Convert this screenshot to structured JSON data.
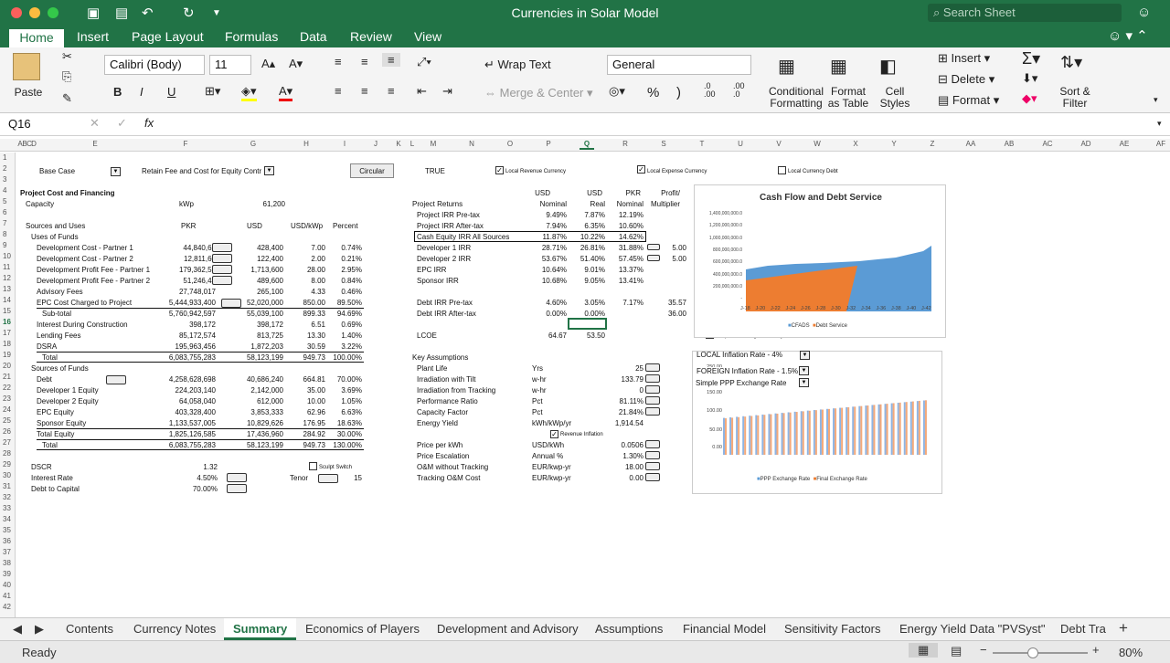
{
  "window": {
    "title": "Currencies in Solar Model",
    "search_placeholder": "Search Sheet"
  },
  "ribbon_tabs": [
    "Home",
    "Insert",
    "Page Layout",
    "Formulas",
    "Data",
    "Review",
    "View"
  ],
  "ribbon": {
    "paste": "Paste",
    "font_name": "Calibri (Body)",
    "font_size": "11",
    "bold": "B",
    "italic": "I",
    "underline": "U",
    "wrap_text": "Wrap Text",
    "merge_center": "Merge & Center",
    "number_format": "General",
    "percent": "%",
    "comma": ")",
    "inc_dec": ".0\n.00",
    "dec_dec": ".00\n.0",
    "cond_format": "Conditional\nFormatting",
    "format_table": "Format\nas Table",
    "cell_styles": "Cell\nStyles",
    "insert": "Insert",
    "delete": "Delete",
    "format": "Format",
    "sort_filter": "Sort &\nFilter"
  },
  "formula_bar": {
    "name_box": "Q16",
    "fx": "fx",
    "formula": ""
  },
  "columns": [
    "A",
    "B",
    "C",
    "D",
    "E",
    "F",
    "G",
    "H",
    "I",
    "J",
    "K",
    "L",
    "M",
    "N",
    "O",
    "P",
    "Q",
    "R",
    "S",
    "T",
    "U",
    "V",
    "W",
    "X",
    "Y",
    "Z",
    "AA",
    "AB",
    "AC",
    "AD",
    "AE",
    "AF"
  ],
  "top": {
    "base_case": "Base Case",
    "retain": "Retain Fee and Cost for Equity Contr",
    "circular": "Circular",
    "true_val": "TRUE",
    "local_rev": "Local Revenue Currency",
    "local_exp": "Local Expense Currency",
    "local_debt": "Local Currency Debt"
  },
  "left": {
    "h4": "Project Cost and Financing",
    "capacity": "Capacity",
    "kwp": "kWp",
    "cap_val": "61,200",
    "h7": "Sources and Uses",
    "pkr": "PKR",
    "usd": "USD",
    "usdkwp": "USD/kWp",
    "percent": "Percent",
    "uses": "Uses of Funds",
    "rows": [
      [
        "Development Cost - Partner 1",
        "44,840,62",
        "428,400",
        "7.00",
        "0.74%"
      ],
      [
        "Development Cost - Partner 2",
        "12,811,60",
        "122,400",
        "2.00",
        "0.21%"
      ],
      [
        "Development Profit Fee - Partner 1",
        "179,362,51",
        "1,713,600",
        "28.00",
        "2.95%"
      ],
      [
        "Development Profit Fee - Partner 2",
        "51,246,43",
        "489,600",
        "8.00",
        "0.84%"
      ],
      [
        "Advisory Fees",
        "27,748,017",
        "265,100",
        "4.33",
        "0.46%"
      ],
      [
        "EPC Cost Charged to Project",
        "5,444,933,400",
        "52,020,000",
        "850.00",
        "89.50%"
      ],
      [
        "Sub-total",
        "5,760,942,597",
        "55,039,100",
        "899.33",
        "94.69%"
      ],
      [
        "Interest During Construction",
        "398,172",
        "398,172",
        "6.51",
        "0.69%"
      ],
      [
        "Lending Fees",
        "85,172,574",
        "813,725",
        "13.30",
        "1.40%"
      ],
      [
        "DSRA",
        "195,963,456",
        "1,872,203",
        "30.59",
        "3.22%"
      ],
      [
        "Total",
        "6,083,755,283",
        "58,123,199",
        "949.73",
        "100.00%"
      ]
    ],
    "sources": "Sources of Funds",
    "srows": [
      [
        "Debt",
        "4,258,628,698",
        "40,686,240",
        "664.81",
        "70.00%"
      ],
      [
        "Developer 1 Equity",
        "224,203,140",
        "2,142,000",
        "35.00",
        "3.69%"
      ],
      [
        "Developer 2 Equity",
        "64,058,040",
        "612,000",
        "10.00",
        "1.05%"
      ],
      [
        "EPC Equity",
        "403,328,400",
        "3,853,333",
        "62.96",
        "6.63%"
      ],
      [
        "Sponsor Equity",
        "1,133,537,005",
        "10,829,626",
        "176.95",
        "18.63%"
      ],
      [
        "Total Equity",
        "1,825,126,585",
        "17,436,960",
        "284.92",
        "30.00%"
      ],
      [
        "Total",
        "6,083,755,283",
        "58,123,199",
        "949.73",
        "130.00%"
      ]
    ],
    "dscr": "DSCR",
    "dscr_val": "1.32",
    "sculpt": "Sculpt Switch",
    "ir": "Interest Rate",
    "ir_val": "4.50%",
    "tenor": "Tenor",
    "tenor_val": "15",
    "dtc": "Debt to Capital",
    "dtc_val": "70.00%"
  },
  "returns": {
    "hdr1": [
      "USD",
      "USD",
      "PKR",
      "Profit/"
    ],
    "hdr2": [
      "Nominal",
      "Real",
      "Nominal",
      "Multiplier"
    ],
    "title": "Project Returns",
    "rows": [
      [
        "Project IRR Pre-tax",
        "9.49%",
        "7.87%",
        "12.19%",
        ""
      ],
      [
        "Project IRR After-tax",
        "7.94%",
        "6.35%",
        "10.60%",
        ""
      ],
      [
        "Cash Equity IRR All Sources",
        "11.87%",
        "10.22%",
        "14.62%",
        ""
      ],
      [
        "Developer 1 IRR",
        "28.71%",
        "26.81%",
        "31.88%",
        "5.00"
      ],
      [
        "Developer 2 IRR",
        "53.67%",
        "51.40%",
        "57.45%",
        "5.00"
      ],
      [
        "EPC IRR",
        "10.64%",
        "9.01%",
        "13.37%",
        ""
      ],
      [
        "Sponsor IRR",
        "10.68%",
        "9.05%",
        "13.41%",
        ""
      ]
    ],
    "debt": [
      [
        "Debt IRR Pre-tax",
        "4.60%",
        "3.05%",
        "7.17%",
        "35.57"
      ],
      [
        "Debt IRR After-tax",
        "0.00%",
        "0.00%",
        "",
        "36.00"
      ]
    ],
    "lcoe": "LCOE",
    "lcoe1": "64.67",
    "lcoe2": "53.50"
  },
  "assump": {
    "title": "Key Assumptions",
    "rows": [
      [
        "Plant Life",
        "Yrs",
        "25"
      ],
      [
        "Irradiation with Tilt",
        "w-hr",
        "133.79"
      ],
      [
        "Irradiation from Tracking",
        "w-hr",
        "0"
      ],
      [
        "Performance Ratio",
        "Pct",
        "81.11%"
      ],
      [
        "Capacity Factor",
        "Pct",
        "21.84%"
      ],
      [
        "Energy Yield",
        "kWh/kWp/yr",
        "1,914.54"
      ]
    ],
    "rev_infl": "Revenue Inflation",
    "rows2": [
      [
        "Price per kWh",
        "USD/kWh",
        "0.0506"
      ],
      [
        "Price Escalation",
        "Annual %",
        "1.30%"
      ],
      [
        "O&M without Tracking",
        "EUR/kwp-yr",
        "18.00"
      ],
      [
        "Tracking O&M Cost",
        "EUR/kwp-yr",
        "0.00"
      ]
    ]
  },
  "chart1": {
    "title": "Cash Flow and Debt Service",
    "yticks": [
      "1,400,000,000.0",
      "1,200,000,000.0",
      "1,000,000,000.0",
      "800,000,000.0",
      "600,000,000.0",
      "400,000,000.0",
      "200,000,000.0",
      "-"
    ],
    "xticks": [
      "J-18",
      "J-20",
      "J-22",
      "J-24",
      "J-26",
      "J-28",
      "J-30",
      "J-32",
      "J-34",
      "J-36",
      "J-38",
      "J-40",
      "J-42"
    ],
    "legend": [
      "CFADS",
      "Debt Service"
    ],
    "graphs_label": "Graphs in Foreign Currency",
    "color1": "#5b9bd5",
    "color2": "#ed7d31"
  },
  "chart2": {
    "dd1": "LOCAL Inflation Rate - 4%",
    "dd2": "FOREIGN Inflation Rate - 1.5%",
    "dd3": "Simple PPP Exchange Rate",
    "yticks": [
      "250.00",
      "150.00",
      "100.00",
      "50.00",
      "0.00"
    ],
    "legend": [
      "PPP Exchange Rate",
      "Final Exchange Rate"
    ]
  },
  "sheet_tabs": [
    "Contents",
    "Currency Notes",
    "Summary",
    "Economics of Players",
    "Development and Advisory",
    "Assumptions",
    "Financial Model",
    "Sensitivity Factors",
    "Energy Yield Data \"PVSyst\"",
    "Debt Tra"
  ],
  "status": {
    "ready": "Ready",
    "zoom": "80%"
  }
}
